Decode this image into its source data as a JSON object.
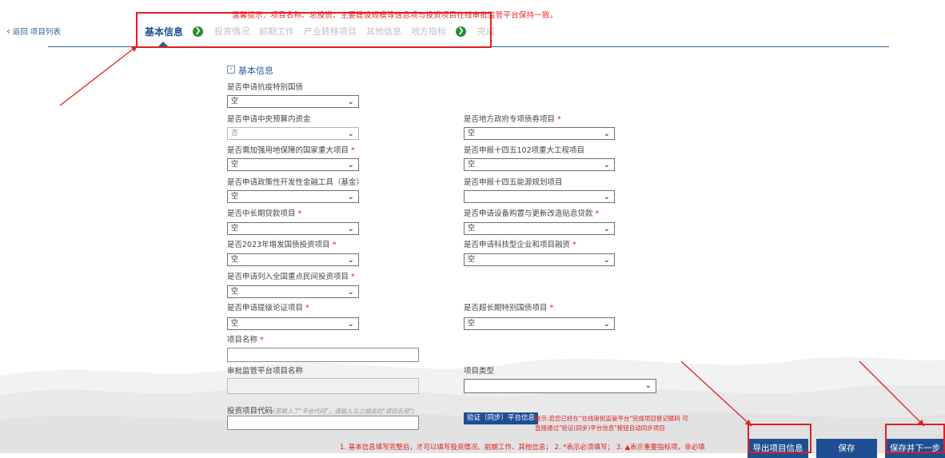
{
  "header": {
    "warning": "温馨提示：项目名称、总投资、主要建设规模等信息项与投资项目在线审批监管平台保持一致。",
    "back_label": "返回 项目列表",
    "tabs": [
      {
        "label": "基本信息",
        "active": true
      },
      {
        "label": "投资情况",
        "active": false
      },
      {
        "label": "前期工作",
        "active": false
      },
      {
        "label": "产业转移项目",
        "active": false
      },
      {
        "label": "其他信息",
        "active": false
      },
      {
        "label": "地方指标",
        "active": false
      },
      {
        "label": "完成",
        "active": false
      }
    ]
  },
  "section": {
    "toggle": "-",
    "title": "基本信息"
  },
  "form": {
    "f1": {
      "label": "是否申请抗疫特别国债",
      "required": "",
      "value": "空"
    },
    "f2": {
      "label": "是否申请中央预算内资金",
      "required": "",
      "value": "否"
    },
    "f3": {
      "label": "是否地方政府专项债券项目",
      "required": "*",
      "value": "空"
    },
    "f4": {
      "label": "是否需加强用地保障的国家重大项目",
      "required": "*",
      "value": "空"
    },
    "f5": {
      "label": "是否申报十四五102项重大工程项目",
      "required": "",
      "value": "空"
    },
    "f6": {
      "label": "是否申请政策性开发性金融工具（基金）",
      "required": "",
      "value": "空"
    },
    "f7": {
      "label": "是否申报十四五能源规划项目",
      "required": "",
      "value": ""
    },
    "f8": {
      "label": "是否中长期贷款项目",
      "required": "*",
      "value": "空"
    },
    "f9": {
      "label": "是否申请设备购置与更新改造贴息贷款",
      "required": "*",
      "value": "空"
    },
    "f10": {
      "label": "是否2023年增发国债投资项目",
      "required": "*",
      "value": "空"
    },
    "f11": {
      "label": "是否申请科技型企业和项目融资",
      "required": "*",
      "value": "空"
    },
    "f12": {
      "label": "是否申请列入全国重点民间投资项目",
      "required": "*",
      "value": "空"
    },
    "f13": {
      "label": "是否申请提级论证项目",
      "required": "*",
      "value": "空"
    },
    "f14": {
      "label": "是否超长期特别国债项目",
      "required": "*",
      "value": "空"
    },
    "name": {
      "label": "项目名称",
      "required": "*",
      "value": ""
    },
    "platform_name": {
      "label": "审批监管平台项目名称",
      "value": ""
    },
    "project_type": {
      "label": "项目类型",
      "value": ""
    },
    "code": {
      "label": "投资项目代码",
      "hint": "(若输入了\"平台代码\"，请输入与之相关的\"项目名称\")",
      "value": ""
    }
  },
  "verify": {
    "button": "验证（同步）平台信息",
    "tip_line1": "提示:若您已经在\"在线审批监管平台\"完成项目登记赋码 可",
    "tip_line2": "直接通过\"验证(同步)平台信息\"按钮自动同步项目"
  },
  "bottom_note": "1. 基本信息填写完整后，才可以填写投资情况、前期工作、其他信息； 2. *表示必须填写； 3. ▲表示重要指标项，非必填",
  "buttons": {
    "export": "导出项目信息",
    "save": "保存",
    "save_next": "保存并下一步"
  },
  "colors": {
    "brand": "#1f4f93",
    "annotation": "#e02020",
    "success": "#2e8b3a"
  },
  "icons": {
    "back": "chevron-left-icon",
    "tab_separator": "arrow-right-circle-icon",
    "select": "chevron-down-icon"
  }
}
